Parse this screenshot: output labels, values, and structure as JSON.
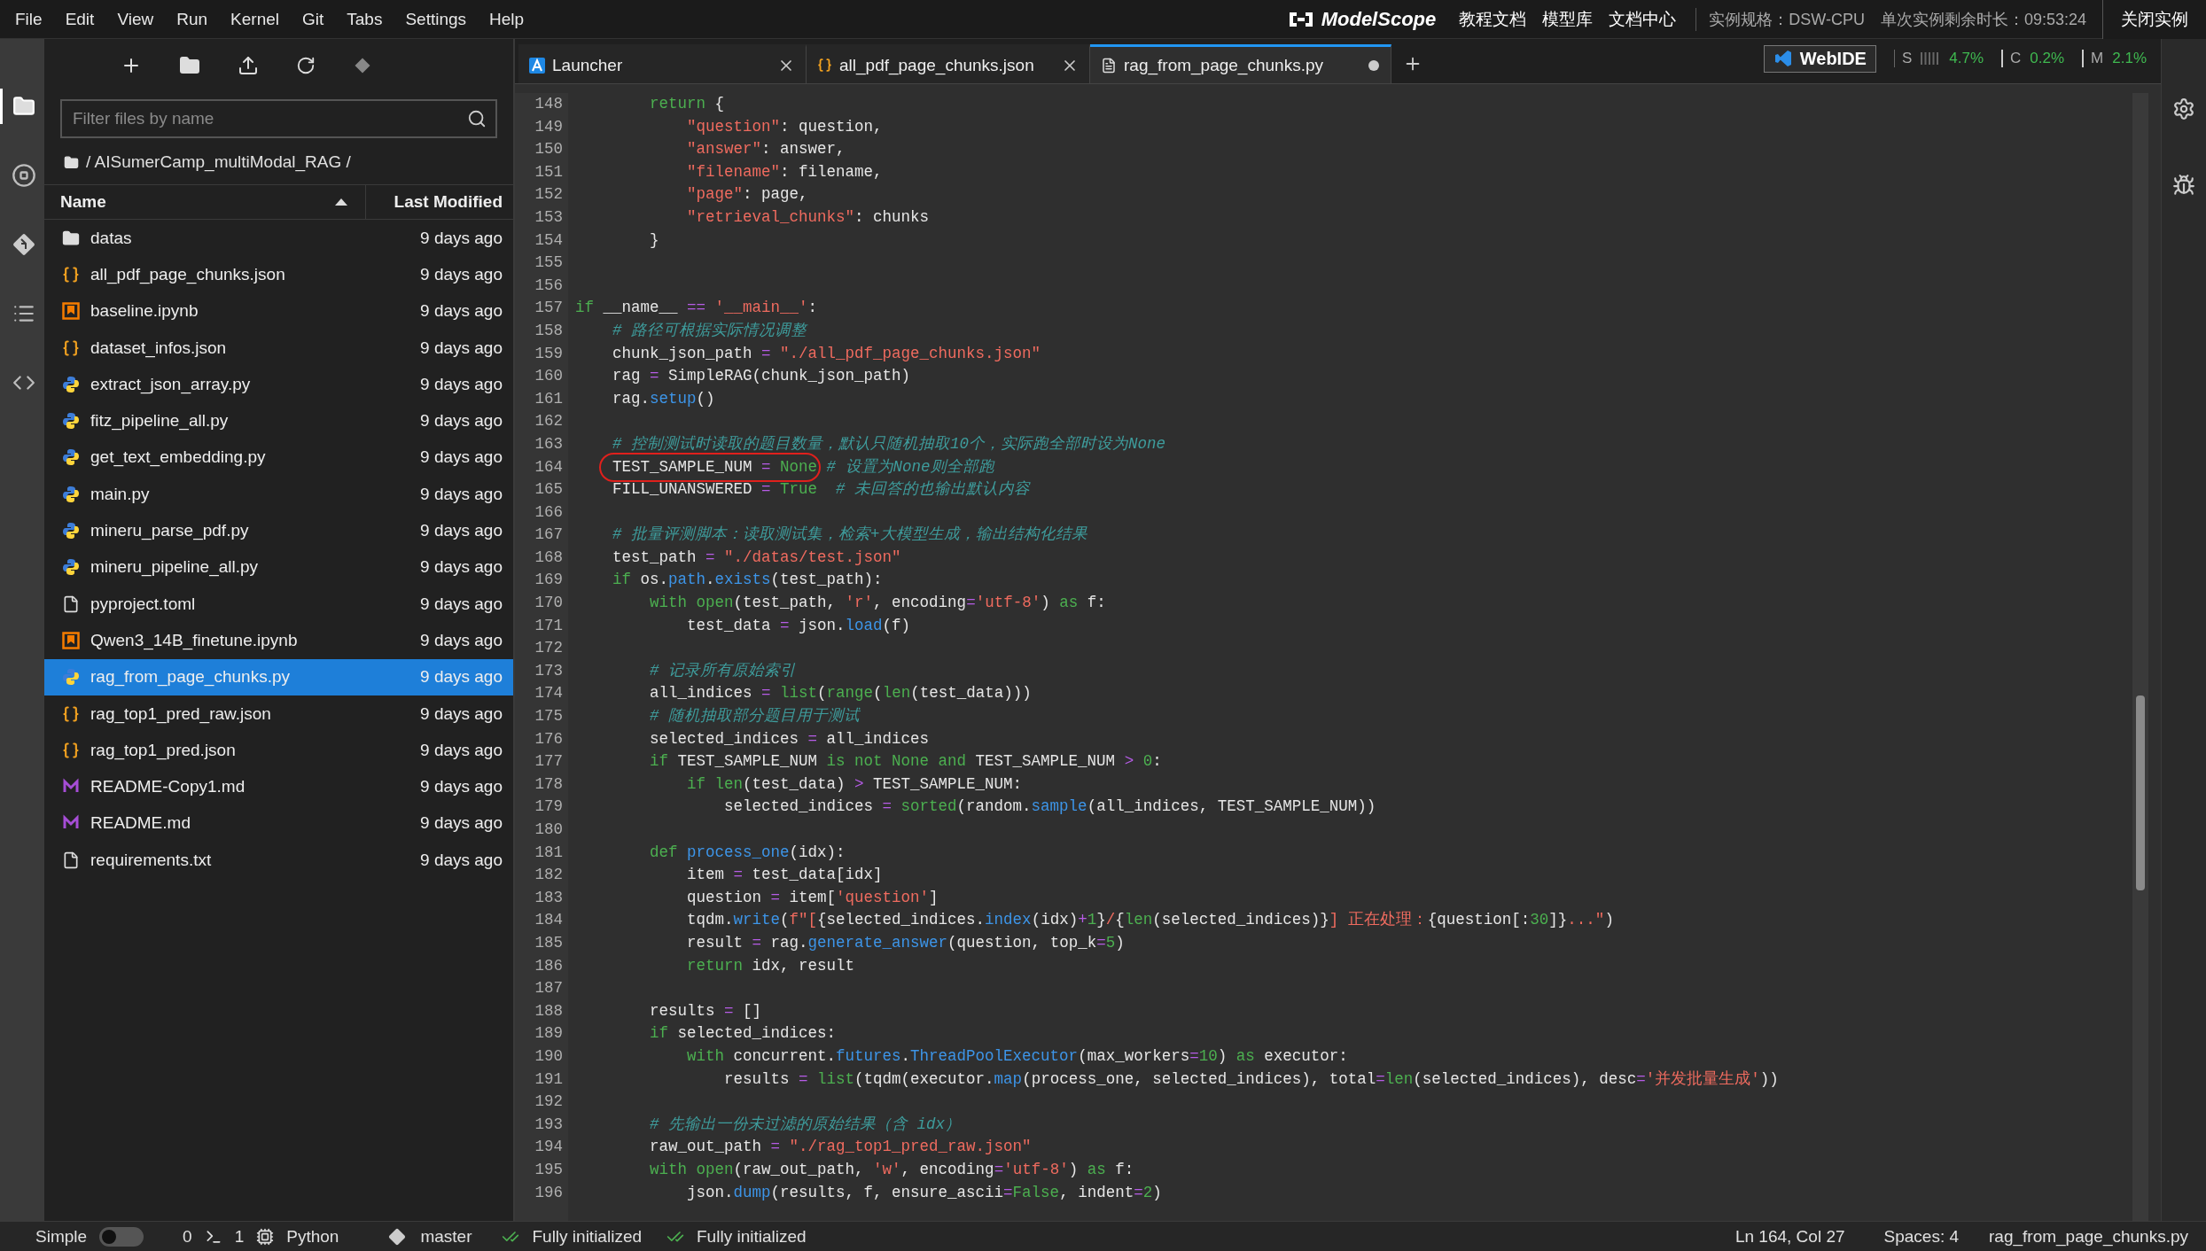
{
  "menu": [
    "File",
    "Edit",
    "View",
    "Run",
    "Kernel",
    "Git",
    "Tabs",
    "Settings",
    "Help"
  ],
  "header": {
    "logo": "ModelScope",
    "links": [
      "教程文档",
      "模型库",
      "文档中心"
    ],
    "instance_spec": "实例规格：DSW-CPU",
    "remaining": "单次实例剩余时长：09:53:24",
    "close_button": "关闭实例"
  },
  "activity_bar": [
    {
      "kind": "files",
      "selected": true
    },
    {
      "kind": "running",
      "selected": false
    },
    {
      "kind": "git",
      "selected": false
    },
    {
      "kind": "toc",
      "selected": false
    },
    {
      "kind": "code",
      "selected": false
    }
  ],
  "file_browser": {
    "search": {
      "placeholder": "Filter files by name"
    },
    "breadcrumb": "/ AISumerCamp_multiModal_RAG /",
    "columns": [
      {
        "label": "Name",
        "sorted": true
      },
      {
        "label": "Last Modified",
        "sorted": false
      }
    ],
    "files": [
      {
        "name": "datas",
        "kind": "folder",
        "modified": "9 days ago",
        "selected": false
      },
      {
        "name": "all_pdf_page_chunks.json",
        "kind": "json",
        "modified": "9 days ago",
        "selected": false
      },
      {
        "name": "baseline.ipynb",
        "kind": "notebook",
        "modified": "9 days ago",
        "selected": false
      },
      {
        "name": "dataset_infos.json",
        "kind": "json",
        "modified": "9 days ago",
        "selected": false
      },
      {
        "name": "extract_json_array.py",
        "kind": "python",
        "modified": "9 days ago",
        "selected": false
      },
      {
        "name": "fitz_pipeline_all.py",
        "kind": "python",
        "modified": "9 days ago",
        "selected": false
      },
      {
        "name": "get_text_embedding.py",
        "kind": "python",
        "modified": "9 days ago",
        "selected": false
      },
      {
        "name": "main.py",
        "kind": "python",
        "modified": "9 days ago",
        "selected": false
      },
      {
        "name": "mineru_parse_pdf.py",
        "kind": "python",
        "modified": "9 days ago",
        "selected": false
      },
      {
        "name": "mineru_pipeline_all.py",
        "kind": "python",
        "modified": "9 days ago",
        "selected": false
      },
      {
        "name": "pyproject.toml",
        "kind": "text",
        "modified": "9 days ago",
        "selected": false
      },
      {
        "name": "Qwen3_14B_finetune.ipynb",
        "kind": "notebook",
        "modified": "9 days ago",
        "selected": false
      },
      {
        "name": "rag_from_page_chunks.py",
        "kind": "python",
        "modified": "9 days ago",
        "selected": true
      },
      {
        "name": "rag_top1_pred_raw.json",
        "kind": "json",
        "modified": "9 days ago",
        "selected": false
      },
      {
        "name": "rag_top1_pred.json",
        "kind": "json",
        "modified": "9 days ago",
        "selected": false
      },
      {
        "name": "README-Copy1.md",
        "kind": "markdown",
        "modified": "9 days ago",
        "selected": false
      },
      {
        "name": "README.md",
        "kind": "markdown",
        "modified": "9 days ago",
        "selected": false
      },
      {
        "name": "requirements.txt",
        "kind": "text",
        "modified": "9 days ago",
        "selected": false
      }
    ]
  },
  "tabs": [
    {
      "label": "Launcher",
      "kind": "launcher",
      "selected": false,
      "dirty": false
    },
    {
      "label": "all_pdf_page_chunks.json",
      "kind": "json",
      "selected": false,
      "dirty": false
    },
    {
      "label": "rag_from_page_chunks.py",
      "kind": "text",
      "selected": true,
      "dirty": true
    }
  ],
  "resources": {
    "webide": "WebIDE",
    "metrics": [
      {
        "label": "S",
        "value": "4.7%",
        "kind": "bars"
      },
      {
        "label": "C",
        "value": "0.2%",
        "kind": "plain"
      },
      {
        "label": "M",
        "value": "2.1%",
        "kind": "plain"
      }
    ]
  },
  "editor": {
    "lines": [
      {
        "number": "148",
        "tokens": [
          {
            "kind": "keyword",
            "text": "        return"
          },
          {
            "kind": "plain",
            "text": " {"
          }
        ]
      },
      {
        "number": "149",
        "tokens": [
          {
            "kind": "string",
            "text": "            \"question\""
          },
          {
            "kind": "plain",
            "text": ": question,"
          }
        ]
      },
      {
        "number": "150",
        "tokens": [
          {
            "kind": "string",
            "text": "            \"answer\""
          },
          {
            "kind": "plain",
            "text": ": answer,"
          }
        ]
      },
      {
        "number": "151",
        "tokens": [
          {
            "kind": "string",
            "text": "            \"filename\""
          },
          {
            "kind": "plain",
            "text": ": filename,"
          }
        ]
      },
      {
        "number": "152",
        "tokens": [
          {
            "kind": "string",
            "text": "            \"page\""
          },
          {
            "kind": "plain",
            "text": ": page,"
          }
        ]
      },
      {
        "number": "153",
        "tokens": [
          {
            "kind": "string",
            "text": "            \"retrieval_chunks\""
          },
          {
            "kind": "plain",
            "text": ": chunks"
          }
        ]
      },
      {
        "number": "154",
        "tokens": [
          {
            "kind": "plain",
            "text": "        }"
          }
        ]
      },
      {
        "number": "155"
      },
      {
        "number": "156"
      },
      {
        "number": "157",
        "tokens": [
          {
            "kind": "keyword",
            "text": "if"
          },
          {
            "kind": "plain",
            "text": " __name__ "
          },
          {
            "kind": "operator",
            "text": "=="
          },
          {
            "kind": "string",
            "text": " '__main__'"
          },
          {
            "kind": "plain",
            "text": ":"
          }
        ]
      },
      {
        "number": "158",
        "tokens": [
          {
            "kind": "comment",
            "text": "    # 路径可根据实际情况调整"
          }
        ]
      },
      {
        "number": "159",
        "tokens": [
          {
            "kind": "plain",
            "text": "    chunk_json_path "
          },
          {
            "kind": "operator",
            "text": "="
          },
          {
            "kind": "string",
            "text": " \"./all_pdf_page_chunks.json\""
          }
        ]
      },
      {
        "number": "160",
        "tokens": [
          {
            "kind": "plain",
            "text": "    rag "
          },
          {
            "kind": "operator",
            "text": "="
          },
          {
            "kind": "plain",
            "text": " SimpleRAG(chunk_json_path)"
          }
        ]
      },
      {
        "number": "161",
        "tokens": [
          {
            "kind": "plain",
            "text": "    rag."
          },
          {
            "kind": "function",
            "text": "setup"
          },
          {
            "kind": "plain",
            "text": "()"
          }
        ]
      },
      {
        "number": "162"
      },
      {
        "number": "163",
        "tokens": [
          {
            "kind": "comment",
            "text": "    # 控制测试时读取的题目数量，默认只随机抽取10个，实际跑全部时设为None"
          }
        ]
      },
      {
        "number": "164",
        "circled": true,
        "tokens": [
          {
            "kind": "plain",
            "text": "    TEST_SAMPLE_NUM "
          },
          {
            "kind": "operator",
            "text": "="
          },
          {
            "kind": "keyword",
            "text": " None"
          },
          {
            "kind": "comment",
            "text": " # 设置为None则全部跑"
          }
        ]
      },
      {
        "number": "165",
        "tokens": [
          {
            "kind": "plain",
            "text": "    FILL_UNANSWERED "
          },
          {
            "kind": "operator",
            "text": "="
          },
          {
            "kind": "keyword",
            "text": " True"
          },
          {
            "kind": "comment",
            "text": "  # 未回答的也输出默认内容"
          }
        ]
      },
      {
        "number": "166"
      },
      {
        "number": "167",
        "tokens": [
          {
            "kind": "comment",
            "text": "    # 批量评测脚本：读取测试集，检索+大模型生成，输出结构化结果"
          }
        ]
      },
      {
        "number": "168",
        "tokens": [
          {
            "kind": "plain",
            "text": "    test_path "
          },
          {
            "kind": "operator",
            "text": "="
          },
          {
            "kind": "string",
            "text": " \"./datas/test.json\""
          }
        ]
      },
      {
        "number": "169",
        "tokens": [
          {
            "kind": "keyword",
            "text": "    if"
          },
          {
            "kind": "plain",
            "text": " os."
          },
          {
            "kind": "function",
            "text": "path"
          },
          {
            "kind": "plain",
            "text": "."
          },
          {
            "kind": "function",
            "text": "exists"
          },
          {
            "kind": "plain",
            "text": "(test_path):"
          }
        ]
      },
      {
        "number": "170",
        "tokens": [
          {
            "kind": "keyword",
            "text": "        with"
          },
          {
            "kind": "keyword",
            "text": " open"
          },
          {
            "kind": "plain",
            "text": "(test_path, "
          },
          {
            "kind": "string",
            "text": "'r'"
          },
          {
            "kind": "plain",
            "text": ", encoding"
          },
          {
            "kind": "operator",
            "text": "="
          },
          {
            "kind": "string",
            "text": "'utf-8'"
          },
          {
            "kind": "plain",
            "text": ") "
          },
          {
            "kind": "keyword",
            "text": "as"
          },
          {
            "kind": "plain",
            "text": " f:"
          }
        ]
      },
      {
        "number": "171",
        "tokens": [
          {
            "kind": "plain",
            "text": "            test_data "
          },
          {
            "kind": "operator",
            "text": "="
          },
          {
            "kind": "plain",
            "text": " json."
          },
          {
            "kind": "function",
            "text": "load"
          },
          {
            "kind": "plain",
            "text": "(f)"
          }
        ]
      },
      {
        "number": "172"
      },
      {
        "number": "173",
        "tokens": [
          {
            "kind": "comment",
            "text": "        # 记录所有原始索引"
          }
        ]
      },
      {
        "number": "174",
        "tokens": [
          {
            "kind": "plain",
            "text": "        all_indices "
          },
          {
            "kind": "operator",
            "text": "="
          },
          {
            "kind": "keyword",
            "text": " list"
          },
          {
            "kind": "plain",
            "text": "("
          },
          {
            "kind": "keyword",
            "text": "range"
          },
          {
            "kind": "plain",
            "text": "("
          },
          {
            "kind": "keyword",
            "text": "len"
          },
          {
            "kind": "plain",
            "text": "(test_data)))"
          }
        ]
      },
      {
        "number": "175",
        "tokens": [
          {
            "kind": "comment",
            "text": "        # 随机抽取部分题目用于测试"
          }
        ]
      },
      {
        "number": "176",
        "tokens": [
          {
            "kind": "plain",
            "text": "        selected_indices "
          },
          {
            "kind": "operator",
            "text": "="
          },
          {
            "kind": "plain",
            "text": " all_indices"
          }
        ]
      },
      {
        "number": "177",
        "tokens": [
          {
            "kind": "keyword",
            "text": "        if"
          },
          {
            "kind": "plain",
            "text": " TEST_SAMPLE_NUM "
          },
          {
            "kind": "keyword",
            "text": "is not None and"
          },
          {
            "kind": "plain",
            "text": " TEST_SAMPLE_NUM "
          },
          {
            "kind": "operator",
            "text": ">"
          },
          {
            "kind": "number",
            "text": " 0"
          },
          {
            "kind": "plain",
            "text": ":"
          }
        ]
      },
      {
        "number": "178",
        "tokens": [
          {
            "kind": "keyword",
            "text": "            if"
          },
          {
            "kind": "keyword",
            "text": " len"
          },
          {
            "kind": "plain",
            "text": "(test_data) "
          },
          {
            "kind": "operator",
            "text": ">"
          },
          {
            "kind": "plain",
            "text": " TEST_SAMPLE_NUM:"
          }
        ]
      },
      {
        "number": "179",
        "tokens": [
          {
            "kind": "plain",
            "text": "                selected_indices "
          },
          {
            "kind": "operator",
            "text": "="
          },
          {
            "kind": "keyword",
            "text": " sorted"
          },
          {
            "kind": "plain",
            "text": "(random."
          },
          {
            "kind": "function",
            "text": "sample"
          },
          {
            "kind": "plain",
            "text": "(all_indices, TEST_SAMPLE_NUM))"
          }
        ]
      },
      {
        "number": "180"
      },
      {
        "number": "181",
        "tokens": [
          {
            "kind": "keyword",
            "text": "        def"
          },
          {
            "kind": "function",
            "text": " process_one"
          },
          {
            "kind": "plain",
            "text": "(idx):"
          }
        ]
      },
      {
        "number": "182",
        "tokens": [
          {
            "kind": "plain",
            "text": "            item "
          },
          {
            "kind": "operator",
            "text": "="
          },
          {
            "kind": "plain",
            "text": " test_data[idx]"
          }
        ]
      },
      {
        "number": "183",
        "tokens": [
          {
            "kind": "plain",
            "text": "            question "
          },
          {
            "kind": "operator",
            "text": "="
          },
          {
            "kind": "plain",
            "text": " item["
          },
          {
            "kind": "string",
            "text": "'question'"
          },
          {
            "kind": "plain",
            "text": "]"
          }
        ]
      },
      {
        "number": "184",
        "tokens": [
          {
            "kind": "plain",
            "text": "            tqdm."
          },
          {
            "kind": "function",
            "text": "write"
          },
          {
            "kind": "plain",
            "text": "("
          },
          {
            "kind": "string",
            "text": "f\"["
          },
          {
            "kind": "plain",
            "text": "{selected_indices."
          },
          {
            "kind": "function",
            "text": "index"
          },
          {
            "kind": "plain",
            "text": "(idx)"
          },
          {
            "kind": "operator",
            "text": "+"
          },
          {
            "kind": "number",
            "text": "1"
          },
          {
            "kind": "plain",
            "text": "}"
          },
          {
            "kind": "string",
            "text": "/"
          },
          {
            "kind": "plain",
            "text": "{"
          },
          {
            "kind": "keyword",
            "text": "len"
          },
          {
            "kind": "plain",
            "text": "(selected_indices)}"
          },
          {
            "kind": "string",
            "text": "] 正在处理："
          },
          {
            "kind": "plain",
            "text": "{question[:"
          },
          {
            "kind": "number",
            "text": "30"
          },
          {
            "kind": "plain",
            "text": "]}"
          },
          {
            "kind": "string",
            "text": "...\""
          },
          {
            "kind": "plain",
            "text": ")"
          }
        ]
      },
      {
        "number": "185",
        "tokens": [
          {
            "kind": "plain",
            "text": "            result "
          },
          {
            "kind": "operator",
            "text": "="
          },
          {
            "kind": "plain",
            "text": " rag."
          },
          {
            "kind": "function",
            "text": "generate_answer"
          },
          {
            "kind": "plain",
            "text": "(question, top_k"
          },
          {
            "kind": "operator",
            "text": "="
          },
          {
            "kind": "number",
            "text": "5"
          },
          {
            "kind": "plain",
            "text": ")"
          }
        ]
      },
      {
        "number": "186",
        "tokens": [
          {
            "kind": "keyword",
            "text": "            return"
          },
          {
            "kind": "plain",
            "text": " idx, result"
          }
        ]
      },
      {
        "number": "187"
      },
      {
        "number": "188",
        "tokens": [
          {
            "kind": "plain",
            "text": "        results "
          },
          {
            "kind": "operator",
            "text": "="
          },
          {
            "kind": "plain",
            "text": " []"
          }
        ]
      },
      {
        "number": "189",
        "tokens": [
          {
            "kind": "keyword",
            "text": "        if"
          },
          {
            "kind": "plain",
            "text": " selected_indices:"
          }
        ]
      },
      {
        "number": "190",
        "tokens": [
          {
            "kind": "keyword",
            "text": "            with"
          },
          {
            "kind": "plain",
            "text": " concurrent."
          },
          {
            "kind": "function",
            "text": "futures"
          },
          {
            "kind": "plain",
            "text": "."
          },
          {
            "kind": "function",
            "text": "ThreadPoolExecutor"
          },
          {
            "kind": "plain",
            "text": "(max_workers"
          },
          {
            "kind": "operator",
            "text": "="
          },
          {
            "kind": "number",
            "text": "10"
          },
          {
            "kind": "plain",
            "text": ") "
          },
          {
            "kind": "keyword",
            "text": "as"
          },
          {
            "kind": "plain",
            "text": " executor:"
          }
        ]
      },
      {
        "number": "191",
        "tokens": [
          {
            "kind": "plain",
            "text": "                results "
          },
          {
            "kind": "operator",
            "text": "="
          },
          {
            "kind": "keyword",
            "text": " list"
          },
          {
            "kind": "plain",
            "text": "(tqdm(executor."
          },
          {
            "kind": "function",
            "text": "map"
          },
          {
            "kind": "plain",
            "text": "(process_one, selected_indices), total"
          },
          {
            "kind": "operator",
            "text": "="
          },
          {
            "kind": "keyword",
            "text": "len"
          },
          {
            "kind": "plain",
            "text": "(selected_indices), desc"
          },
          {
            "kind": "operator",
            "text": "="
          },
          {
            "kind": "string",
            "text": "'并发批量生成'"
          },
          {
            "kind": "plain",
            "text": "))"
          }
        ]
      },
      {
        "number": "192"
      },
      {
        "number": "193",
        "tokens": [
          {
            "kind": "comment",
            "text": "        # 先输出一份未过滤的原始结果（含 idx）"
          }
        ]
      },
      {
        "number": "194",
        "tokens": [
          {
            "kind": "plain",
            "text": "        raw_out_path "
          },
          {
            "kind": "operator",
            "text": "="
          },
          {
            "kind": "string",
            "text": " \"./rag_top1_pred_raw.json\""
          }
        ]
      },
      {
        "number": "195",
        "tokens": [
          {
            "kind": "keyword",
            "text": "        with"
          },
          {
            "kind": "keyword",
            "text": " open"
          },
          {
            "kind": "plain",
            "text": "(raw_out_path, "
          },
          {
            "kind": "string",
            "text": "'w'"
          },
          {
            "kind": "plain",
            "text": ", encoding"
          },
          {
            "kind": "operator",
            "text": "="
          },
          {
            "kind": "string",
            "text": "'utf-8'"
          },
          {
            "kind": "plain",
            "text": ") "
          },
          {
            "kind": "keyword",
            "text": "as"
          },
          {
            "kind": "plain",
            "text": " f:"
          }
        ]
      },
      {
        "number": "196",
        "tokens": [
          {
            "kind": "plain",
            "text": "            json."
          },
          {
            "kind": "function",
            "text": "dump"
          },
          {
            "kind": "plain",
            "text": "(results, f, ensure_ascii"
          },
          {
            "kind": "operator",
            "text": "="
          },
          {
            "kind": "keyword",
            "text": "False"
          },
          {
            "kind": "plain",
            "text": ", indent"
          },
          {
            "kind": "operator",
            "text": "="
          },
          {
            "kind": "number",
            "text": "2"
          },
          {
            "kind": "plain",
            "text": ")"
          }
        ]
      }
    ]
  },
  "status_bar": {
    "mode": {
      "label": "Simple",
      "on": false
    },
    "terminals": "0",
    "kernels": "1",
    "kernel_name": "Python",
    "branch": "master",
    "lsp": [
      "Fully initialized",
      "Fully initialized"
    ],
    "position": "Ln 164, Col 27",
    "indent": "Spaces: 4",
    "file": "rag_from_page_chunks.py"
  }
}
